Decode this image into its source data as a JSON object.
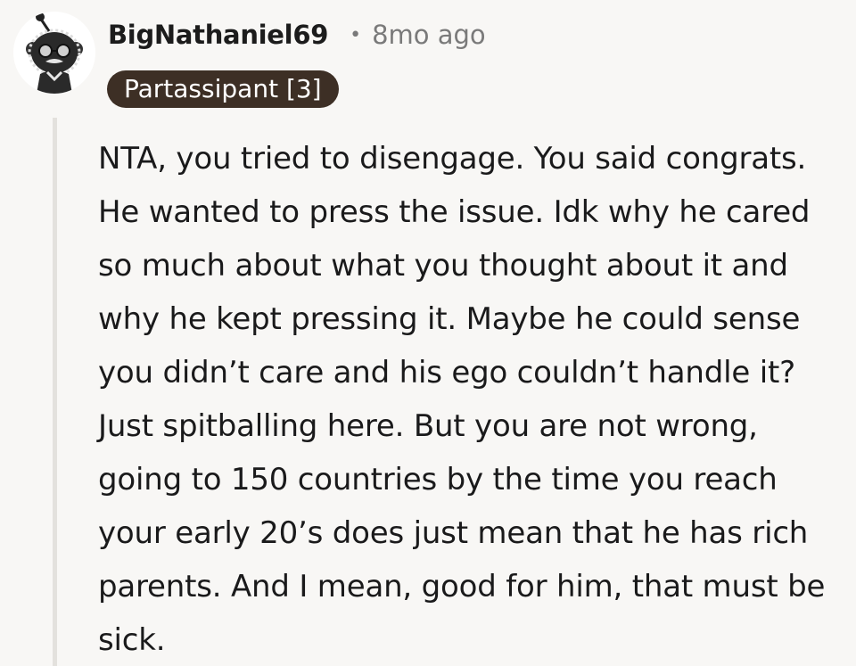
{
  "comment": {
    "author": "BigNathaniel69",
    "separator": "•",
    "timestamp": "8mo ago",
    "flair": "Partassipant [3]",
    "body": "NTA, you tried to disengage. You said congrats. He wanted to press the issue. Idk why he cared so much about what you thought about it and why he kept pressing it. Maybe he could sense you didn’t care and his ego couldn’t handle it? Just spitballing here. But you are not wrong, going to 150 countries by the time you reach your early 20’s does just mean that he has rich parents. And I mean, good for him, that must be sick."
  },
  "colors": {
    "background": "#f8f7f5",
    "flair_background": "#3d2f25",
    "flair_text": "#ffffff",
    "meta_text": "#7a7a7a",
    "thread_line": "#e3e1dd"
  },
  "icons": {
    "avatar": "snoo-avatar-icon"
  }
}
